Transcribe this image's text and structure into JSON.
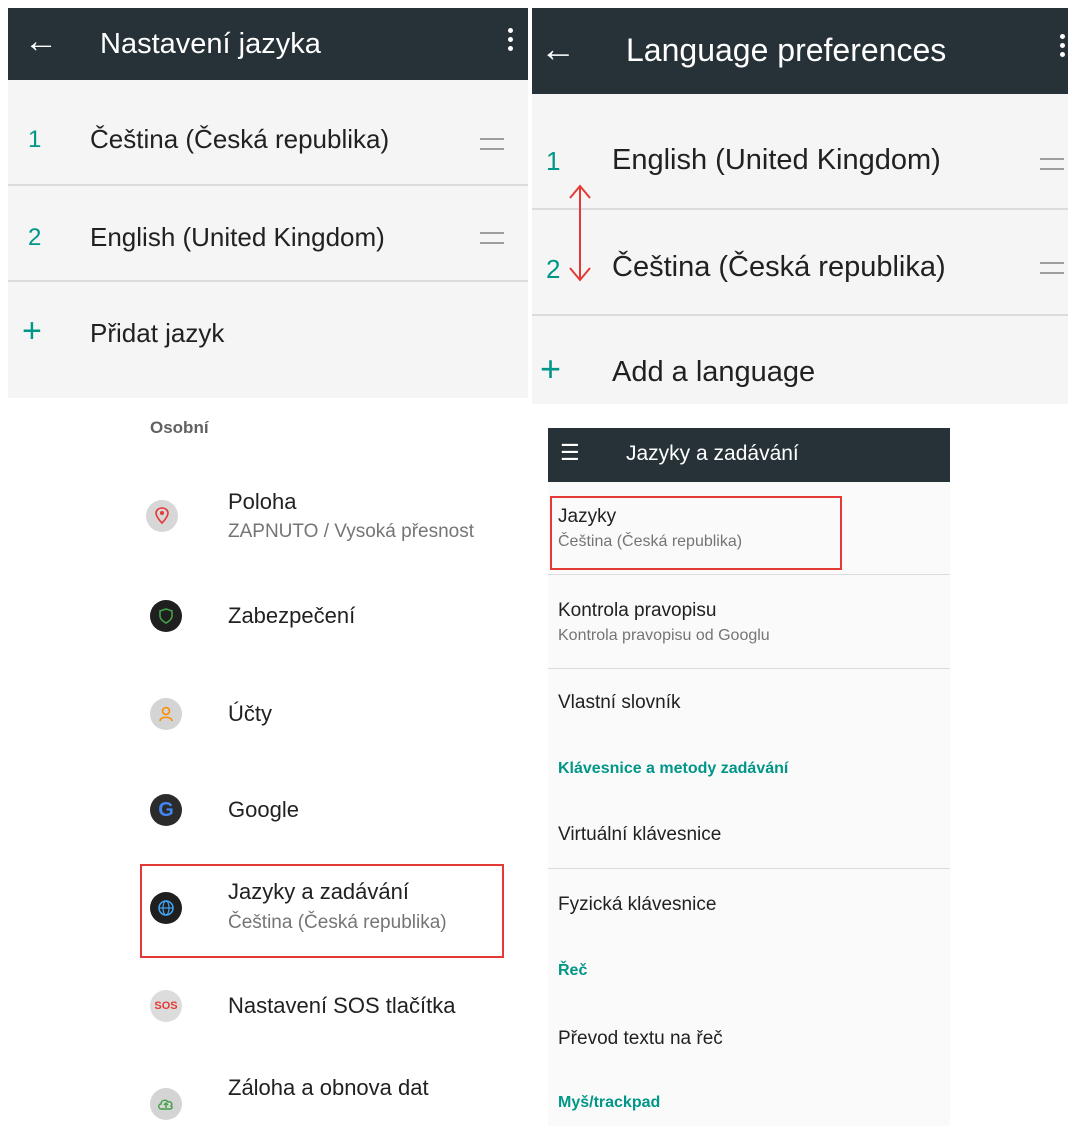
{
  "panel_cz_lang": {
    "title": "Nastavení jazyka",
    "items": [
      {
        "num": "1",
        "label": "Čeština (Česká republika)"
      },
      {
        "num": "2",
        "label": "English (United Kingdom)"
      }
    ],
    "add_label": "Přidat jazyk"
  },
  "panel_en_lang": {
    "title": "Language preferences",
    "items": [
      {
        "num": "1",
        "label": "English (United Kingdom)"
      },
      {
        "num": "2",
        "label": "Čeština (Česká republika)"
      }
    ],
    "add_label": "Add a language"
  },
  "settings": {
    "section": "Osobní",
    "items": [
      {
        "label": "Poloha",
        "sub": "ZAPNUTO / Vysoká přesnost",
        "icon": "location-icon"
      },
      {
        "label": "Zabezpečení",
        "icon": "security-shield-icon"
      },
      {
        "label": "Účty",
        "icon": "accounts-icon"
      },
      {
        "label": "Google",
        "icon": "google-icon"
      },
      {
        "label": "Jazyky a zadávání",
        "sub": "Čeština (Česká republika)",
        "icon": "globe-icon"
      },
      {
        "label": "Nastavení SOS tlačítka",
        "icon": "sos-icon",
        "icon_text": "SOS"
      },
      {
        "label": "Záloha a obnova dat",
        "icon": "cloud-upload-icon"
      }
    ]
  },
  "lang_input": {
    "title": "Jazyky a zadávání",
    "languages": {
      "label": "Jazyky",
      "sub": "Čeština (Česká republika)"
    },
    "spell": {
      "label": "Kontrola pravopisu",
      "sub": "Kontrola pravopisu od Googlu"
    },
    "dictionary": {
      "label": "Vlastní slovník"
    },
    "section_keyboards": "Klávesnice a metody zadávání",
    "virtual_kb": {
      "label": "Virtuální klávesnice"
    },
    "physical_kb": {
      "label": "Fyzická klávesnice"
    },
    "section_speech": "Řeč",
    "tts": {
      "label": "Převod textu na řeč"
    },
    "section_mouse": "Myš/trackpad"
  },
  "colors": {
    "appbar": "#263238",
    "accent": "#009688",
    "highlight": "#e53935"
  }
}
